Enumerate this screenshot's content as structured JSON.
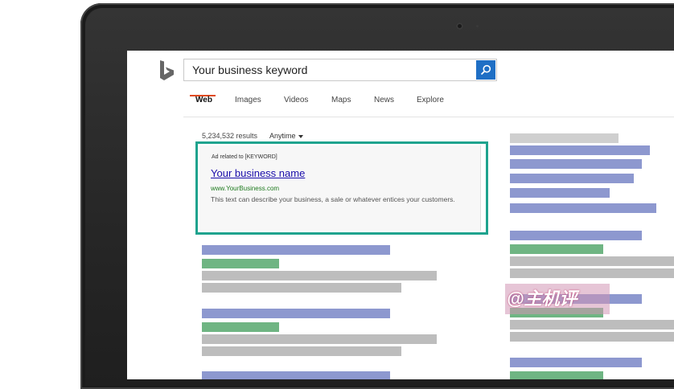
{
  "search": {
    "query": "Your business keyword"
  },
  "tabs": [
    {
      "label": "Web",
      "active": true
    },
    {
      "label": "Images",
      "active": false
    },
    {
      "label": "Videos",
      "active": false
    },
    {
      "label": "Maps",
      "active": false
    },
    {
      "label": "News",
      "active": false
    },
    {
      "label": "Explore",
      "active": false
    }
  ],
  "results_meta": {
    "count": "5,234,532 results",
    "time_filter": "Anytime"
  },
  "ad": {
    "label": "Ad related to [KEYWORD]",
    "title": "Your business name",
    "url": "www.YourBusiness.com",
    "description": "This text can describe your business, a sale or whatever entices your customers."
  },
  "watermark": {
    "text": "@主机评"
  },
  "colors": {
    "accent": "#1fa38e",
    "search_button": "#1f6fc5",
    "active_tab_underline": "#e04a1f",
    "link": "#1a0dab",
    "url": "#1e7a1e",
    "placeholder_blue": "#8d98cf",
    "placeholder_green": "#6fb583",
    "placeholder_gray": "#bdbdbd"
  },
  "icons": {
    "logo": "bing-logo-icon",
    "search": "search-icon"
  }
}
